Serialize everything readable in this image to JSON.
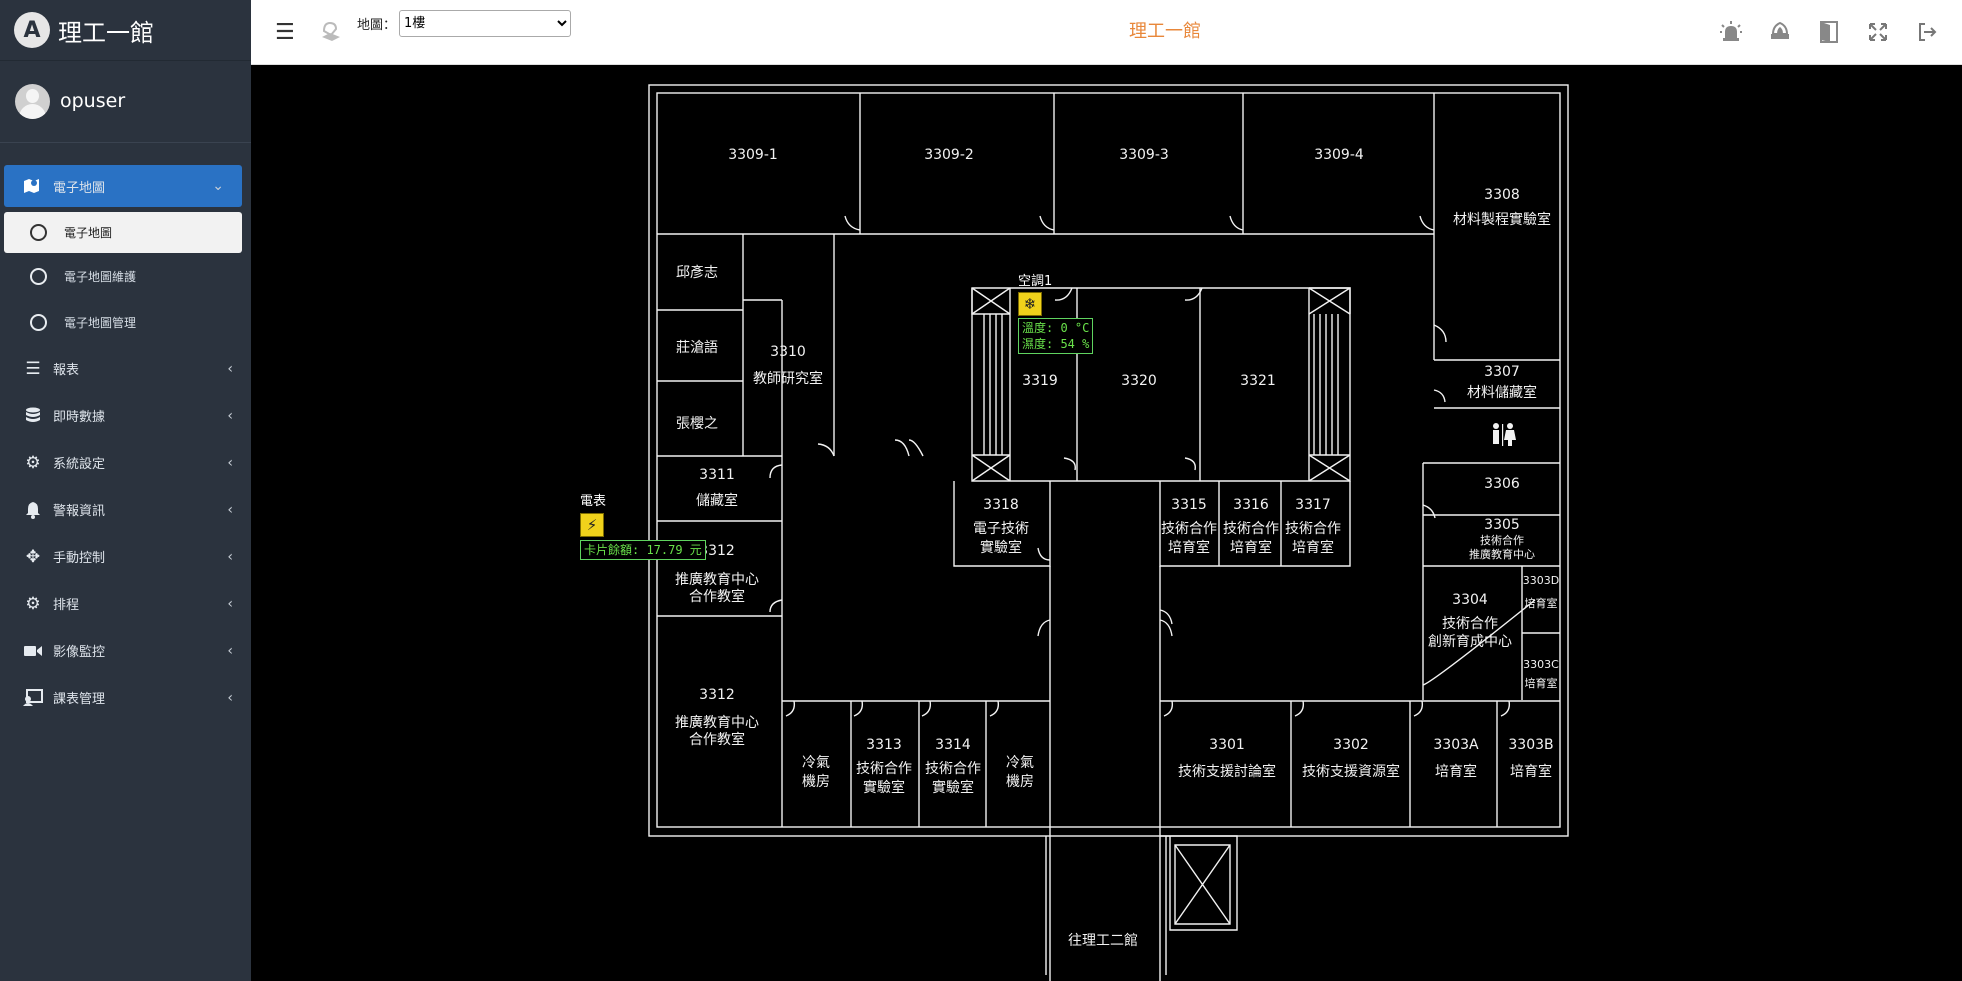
{
  "app": {
    "brand_title": "理工一館",
    "logo_letter": "A"
  },
  "user": {
    "name": "opuser"
  },
  "sidebar": {
    "items": [
      {
        "label": "電子地圖",
        "icon": "map-icon",
        "active": true,
        "children": [
          {
            "label": "電子地圖",
            "active": true
          },
          {
            "label": "電子地圖維護",
            "active": false
          },
          {
            "label": "電子地圖管理",
            "active": false
          }
        ]
      },
      {
        "label": "報表",
        "icon": "report-icon"
      },
      {
        "label": "即時數據",
        "icon": "database-icon"
      },
      {
        "label": "系統設定",
        "icon": "gear-icon"
      },
      {
        "label": "警報資訊",
        "icon": "bell-icon"
      },
      {
        "label": "手動控制",
        "icon": "move-icon"
      },
      {
        "label": "排程",
        "icon": "gears-icon"
      },
      {
        "label": "影像監控",
        "icon": "video-icon"
      },
      {
        "label": "課表管理",
        "icon": "schedule-icon"
      }
    ]
  },
  "topbar": {
    "map_label": "地圖：",
    "map_select": {
      "selected": "1樓",
      "options": [
        "1樓"
      ]
    },
    "page_title": "理工一館",
    "icons": [
      "alarm-light-icon",
      "fire-icon",
      "door-icon",
      "fullscreen-icon",
      "logout-icon"
    ]
  },
  "floorplan": {
    "rooms": {
      "r3309_1": "3309-1",
      "r3309_2": "3309-2",
      "r3309_3": "3309-3",
      "r3309_4": "3309-4",
      "r3308_num": "3308",
      "r3308_name": "材料製程實驗室",
      "office1": "邱彥志",
      "office2": "莊滄語",
      "office3": "張櫻之",
      "r3310_num": "3310",
      "r3310_name": "教師研究室",
      "r3319": "3319",
      "r3320": "3320",
      "r3321": "3321",
      "r3307_num": "3307",
      "r3307_name": "材料儲藏室",
      "r3306": "3306",
      "r3305_num": "3305",
      "r3305_name1": "技術合作",
      "r3305_name2": "推廣教育中心",
      "r3311_num": "3311",
      "r3311_name": "儲藏室",
      "r3318_num": "3318",
      "r3318_name1": "電子技術",
      "r3318_name2": "實驗室",
      "r3315_num": "3315",
      "r3316_num": "3316",
      "r3317_num": "3317",
      "coop": "技術合作",
      "incubation": "培育室",
      "r3312a_num": "3312",
      "r3312a_name1": "推廣教育中心",
      "r3312a_name2": "合作教室",
      "r3304_num": "3304",
      "r3304_name1": "技術合作",
      "r3304_name2": "創新育成中心",
      "r3303d_num": "3303D",
      "r3303c_num": "3303C",
      "r3312b_num": "3312",
      "r3312b_name1": "推廣教育中心",
      "r3312b_name2": "合作教室",
      "ac_room1": "冷氣",
      "ac_room2": "機房",
      "r3313_num": "3313",
      "r3314_num": "3314",
      "lab": "實驗室",
      "r3301_num": "3301",
      "r3301_name": "技術支援討論室",
      "r3302_num": "3302",
      "r3302_name": "技術支援資源室",
      "r3303a_num": "3303A",
      "r3303b_num": "3303B",
      "to_building2": "往理工二館"
    }
  },
  "devices": {
    "ac": {
      "name": "空調1",
      "temp": "溫度: 0 °C",
      "humidity": "濕度: 54 %"
    },
    "meter": {
      "name": "電表",
      "balance": "卡片餘額: 17.79 元"
    }
  },
  "colors": {
    "accent": "#2a72c4",
    "title_orange": "#e8873a",
    "sidebar_bg": "#2b333e",
    "sensor_text": "#69e24a",
    "device_icon": "#f0d21b"
  }
}
